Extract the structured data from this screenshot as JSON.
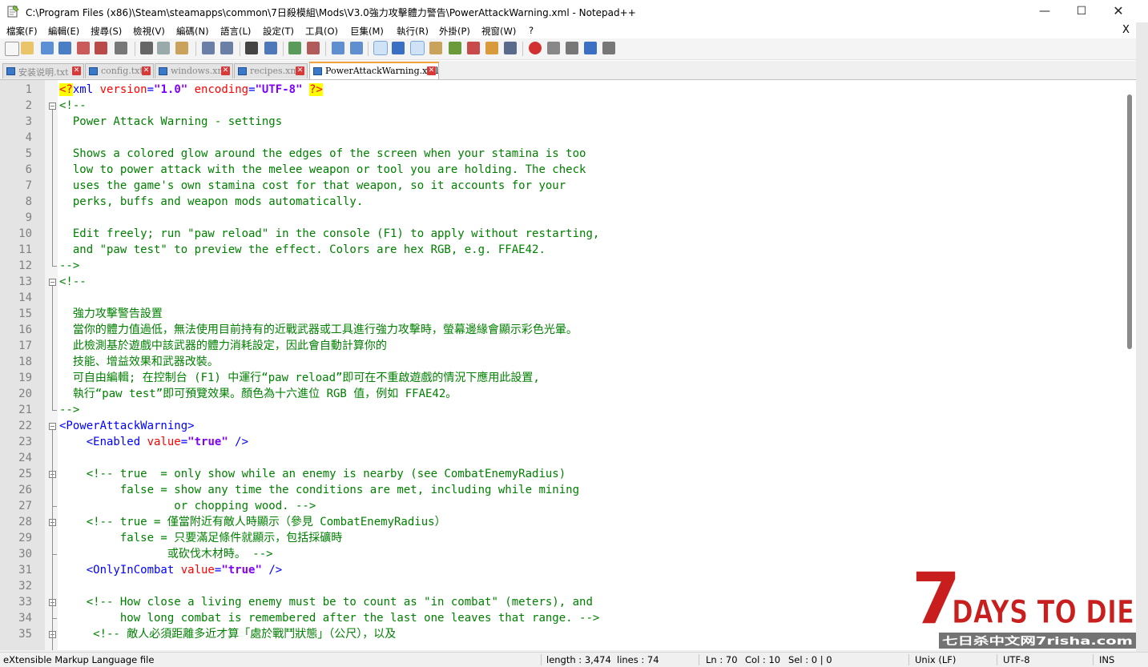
{
  "window": {
    "title": "C:\\Program Files (x86)\\Steam\\steamapps\\common\\7日殺模組\\Mods\\V3.0強力攻擊體力警告\\PowerAttackWarning.xml - Notepad++",
    "minimize_glyph": "—",
    "maximize_glyph": "☐",
    "close_glyph": "✕"
  },
  "menu": {
    "items": [
      "檔案(F)",
      "編輯(E)",
      "搜尋(S)",
      "檢視(V)",
      "編碼(N)",
      "語言(L)",
      "設定(T)",
      "工具(O)",
      "巨集(M)",
      "執行(R)",
      "外掛(P)",
      "視窗(W)",
      "?"
    ],
    "close_glyph": "X"
  },
  "tabs": [
    {
      "label": "安装说明.txt",
      "active": false
    },
    {
      "label": "config.txt",
      "active": false
    },
    {
      "label": "windows.xml",
      "active": false
    },
    {
      "label": "recipes.xml",
      "active": false
    },
    {
      "label": "PowerAttackWarning.xml",
      "active": true
    }
  ],
  "tab_close_glyph": "✕",
  "editor": {
    "line_numbers": [
      "1",
      "2",
      "3",
      "4",
      "5",
      "6",
      "7",
      "8",
      "9",
      "10",
      "11",
      "12",
      "13",
      "14",
      "15",
      "16",
      "17",
      "18",
      "19",
      "20",
      "21",
      "22",
      "23",
      "24",
      "25",
      "26",
      "27",
      "28",
      "29",
      "30",
      "31",
      "32",
      "33",
      "34",
      "35"
    ],
    "lines": [
      [
        {
          "t": "<?",
          "c": "pi"
        },
        {
          "t": "xml ",
          "c": "blue"
        },
        {
          "t": "version",
          "c": "red"
        },
        {
          "t": "=",
          "c": "blue"
        },
        {
          "t": "\"1.0\"",
          "c": "purple"
        },
        {
          "t": " ",
          "c": "blue"
        },
        {
          "t": "encoding",
          "c": "red"
        },
        {
          "t": "=",
          "c": "blue"
        },
        {
          "t": "\"UTF-8\"",
          "c": "purple"
        },
        {
          "t": " ",
          "c": "blue"
        },
        {
          "t": "?>",
          "c": "pi"
        }
      ],
      [
        {
          "t": "<!--",
          "c": "green"
        }
      ],
      [
        {
          "t": "  Power Attack Warning - settings",
          "c": "green"
        }
      ],
      [
        {
          "t": "",
          "c": "green"
        }
      ],
      [
        {
          "t": "  Shows a colored glow around the edges of the screen when your stamina is too",
          "c": "green"
        }
      ],
      [
        {
          "t": "  low to power attack with the melee weapon or tool you are holding. The check",
          "c": "green"
        }
      ],
      [
        {
          "t": "  uses the game's own stamina cost for that weapon, so it accounts for your",
          "c": "green"
        }
      ],
      [
        {
          "t": "  perks, buffs and weapon mods automatically.",
          "c": "green"
        }
      ],
      [
        {
          "t": "",
          "c": "green"
        }
      ],
      [
        {
          "t": "  Edit freely; run \"paw reload\" in the console (F1) to apply without restarting,",
          "c": "green"
        }
      ],
      [
        {
          "t": "  and \"paw test\" to preview the effect. Colors are hex RGB, e.g. FFAE42.",
          "c": "green"
        }
      ],
      [
        {
          "t": "-->",
          "c": "green"
        }
      ],
      [
        {
          "t": "<!--",
          "c": "green"
        }
      ],
      [
        {
          "t": "",
          "c": "green"
        }
      ],
      [
        {
          "t": "  強力攻擊警告設置",
          "c": "green"
        }
      ],
      [
        {
          "t": "  當你的體力值過低，無法使用目前持有的近戰武器或工具進行強力攻擊時，螢幕邊緣會顯示彩色光暈。",
          "c": "green"
        }
      ],
      [
        {
          "t": "  此檢測基於遊戲中該武器的體力消耗設定，因此會自動計算你的",
          "c": "green"
        }
      ],
      [
        {
          "t": "  技能、增益效果和武器改裝。",
          "c": "green"
        }
      ],
      [
        {
          "t": "  可自由編輯; 在控制台 (F1) 中運行“paw reload”即可在不重啟遊戲的情況下應用此設置,",
          "c": "green"
        }
      ],
      [
        {
          "t": "  執行“paw test”即可預覽效果。顏色為十六進位 RGB 值，例如 FFAE42。",
          "c": "green"
        }
      ],
      [
        {
          "t": "-->",
          "c": "green"
        }
      ],
      [
        {
          "t": "<PowerAttackWarning>",
          "c": "blue"
        }
      ],
      [
        {
          "t": "    <Enabled ",
          "c": "blue"
        },
        {
          "t": "value",
          "c": "red"
        },
        {
          "t": "=",
          "c": "blue"
        },
        {
          "t": "\"true\"",
          "c": "purple"
        },
        {
          "t": " />",
          "c": "blue"
        }
      ],
      [
        {
          "t": "",
          "c": "blue"
        }
      ],
      [
        {
          "t": "    <!-- true  = only show while an enemy is nearby (see CombatEnemyRadius)",
          "c": "green"
        }
      ],
      [
        {
          "t": "         false = show any time the conditions are met, including while mining",
          "c": "green"
        }
      ],
      [
        {
          "t": "                 or chopping wood. -->",
          "c": "green"
        }
      ],
      [
        {
          "t": "    <!-- true = 僅當附近有敵人時顯示（參見 CombatEnemyRadius）",
          "c": "green"
        }
      ],
      [
        {
          "t": "         false = 只要滿足條件就顯示，包括採礦時",
          "c": "green"
        }
      ],
      [
        {
          "t": "                或砍伐木材時。 -->",
          "c": "green"
        }
      ],
      [
        {
          "t": "    <OnlyInCombat ",
          "c": "blue"
        },
        {
          "t": "value",
          "c": "red"
        },
        {
          "t": "=",
          "c": "blue"
        },
        {
          "t": "\"true\"",
          "c": "purple"
        },
        {
          "t": " />",
          "c": "blue"
        }
      ],
      [
        {
          "t": "",
          "c": "blue"
        }
      ],
      [
        {
          "t": "    <!-- How close a living enemy must be to count as \"in combat\" (meters), and",
          "c": "green"
        }
      ],
      [
        {
          "t": "         how long combat is remembered after the last one leaves that range. -->",
          "c": "green"
        }
      ],
      [
        {
          "t": "     <!-- 敵人必須距離多近才算「處於戰鬥狀態」（公尺），以及",
          "c": "green"
        }
      ]
    ]
  },
  "status": {
    "file_type": "eXtensible Markup Language file",
    "length": "length : 3,474",
    "lines": "lines : 74",
    "ln": "Ln : 70",
    "col": "Col : 10",
    "sel": "Sel : 0 | 0",
    "eol": "Unix (LF)",
    "encoding": "UTF-8",
    "mode": "INS"
  },
  "watermark": {
    "logo_digit": "7",
    "logo_text": "DAYS TO DIE",
    "site_text": "七日杀中文网7risha.com"
  },
  "colors": {
    "comment": "#008000",
    "tag": "#0000ff",
    "attribute": "#ff0000",
    "attr_value": "#8000ff",
    "pi_highlight": "#ffff00",
    "active_tab_accent": "#f4a23a",
    "watermark_red": "#c81e1e"
  }
}
